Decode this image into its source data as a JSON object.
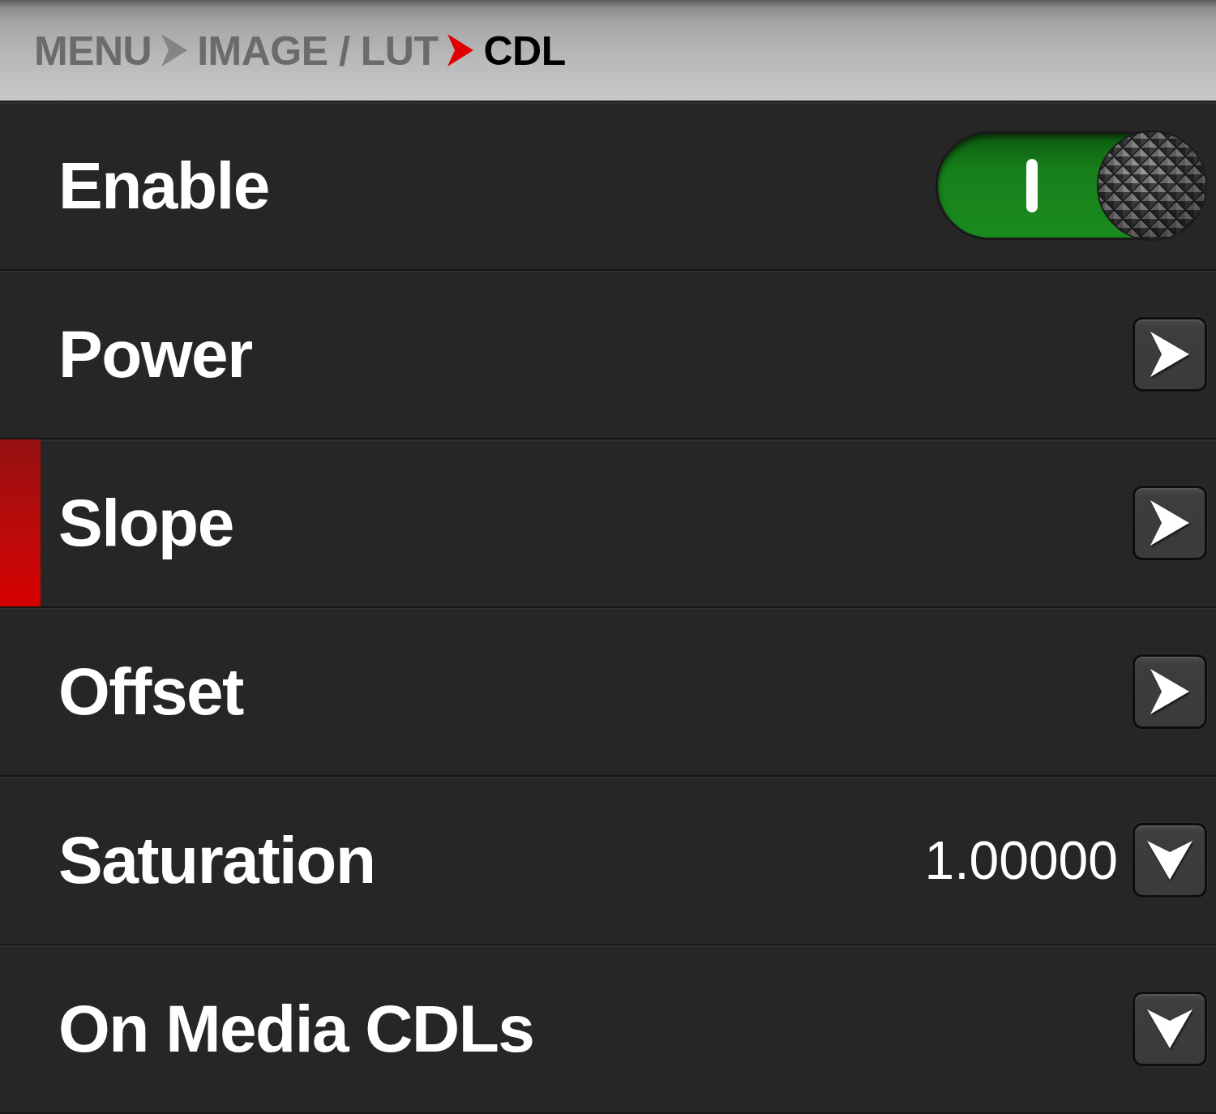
{
  "breadcrumb": [
    {
      "label": "MENU",
      "current": false
    },
    {
      "label": "IMAGE / LUT",
      "current": false
    },
    {
      "label": "CDL",
      "current": true
    }
  ],
  "rows": [
    {
      "kind": "toggle",
      "label": "Enable",
      "selected": false,
      "on": true
    },
    {
      "kind": "submenu",
      "label": "Power",
      "selected": false
    },
    {
      "kind": "submenu",
      "label": "Slope",
      "selected": true
    },
    {
      "kind": "submenu",
      "label": "Offset",
      "selected": false
    },
    {
      "kind": "dropdown",
      "label": "Saturation",
      "selected": false,
      "value": "1.00000"
    },
    {
      "kind": "dropdown",
      "label": "On Media CDLs",
      "selected": false
    }
  ]
}
